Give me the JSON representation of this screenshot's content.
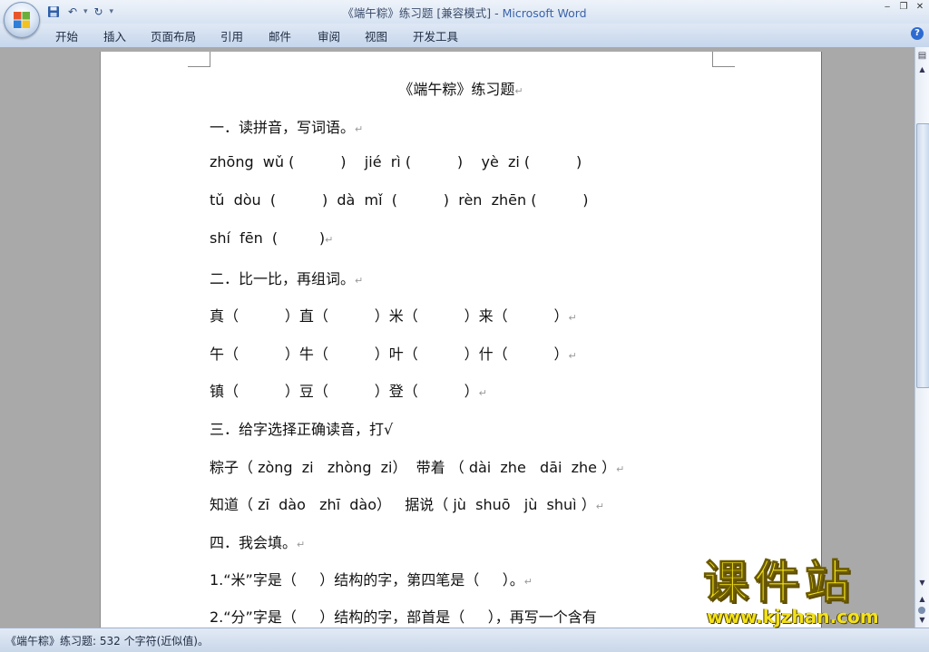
{
  "window": {
    "title_doc": "《端午粽》练习题 [兼容模式]",
    "title_sep": " - ",
    "title_app": "Microsoft Word"
  },
  "qat": {
    "save_icon": "floppy-disk",
    "undo_glyph": "↶",
    "redo_glyph": "↻",
    "customize_glyph": "▾"
  },
  "ribbon_tabs": [
    "开始",
    "插入",
    "页面布局",
    "引用",
    "邮件",
    "审阅",
    "视图",
    "开发工具"
  ],
  "help_glyph": "?",
  "document": {
    "title": "《端午粽》练习题",
    "lines": [
      "一．读拼音，写词语。",
      "zhōng  wǔ (          )    jié  rì (          )    yè  zi (          )",
      "tǔ  dòu  (          )  dà  mǐ  (          )  rèn  zhēn (          )",
      "shí  fēn  (         )",
      "二．比一比，再组词。",
      "真（          ）直（          ）米（          ）来（          ）",
      "午（          ）牛（          ）叶（          ）什（          ）",
      "镇（          ）豆（          ）登（          ）",
      "三．给字选择正确读音，打√",
      "粽子（ zòng  zi   zhòng  zi）  带着 （ dài  zhe   dāi  zhe ）",
      "知道（ zī  dào   zhī  dào）   据说（ jù  shuō   jù  shuì ）",
      "四．我会填。",
      "1.“米”字是（     ）结构的字，第四笔是（     ）。",
      "2.“分”字是（     ）结构的字，部首是（     ），再写一个含有"
    ],
    "para_mark": "↵"
  },
  "status": {
    "text": "《端午粽》练习题: 532 个字符(近似值)。"
  },
  "watermark": {
    "main": "课件站",
    "url": "www.kjzhan.com"
  },
  "colors": {
    "accent": "#3b63a8",
    "watermark_yellow": "#f3e21a"
  }
}
